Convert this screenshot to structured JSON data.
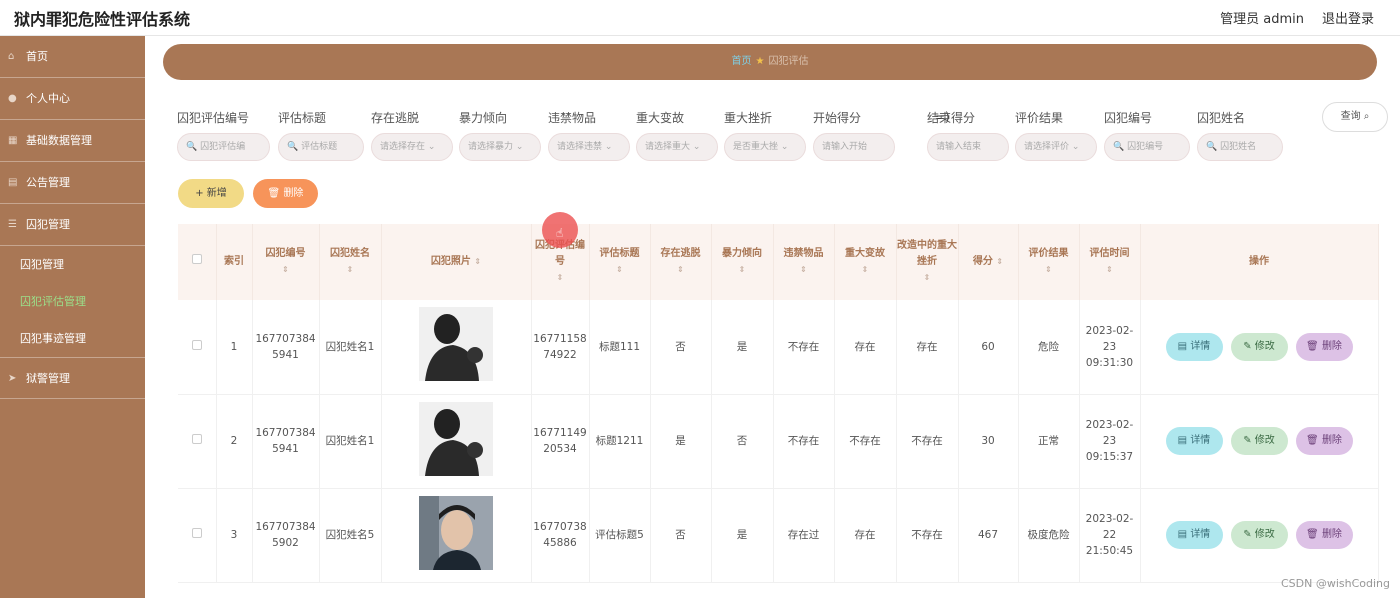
{
  "app": {
    "title": "狱内罪犯危险性评估系统",
    "user": "管理员 admin",
    "logout": "退出登录"
  },
  "sidebar": {
    "items": [
      {
        "label": "首页",
        "icon": "home-icon"
      },
      {
        "label": "个人中心",
        "icon": "user-icon"
      },
      {
        "label": "基础数据管理",
        "icon": "grid-icon"
      },
      {
        "label": "公告管理",
        "icon": "notice-icon"
      },
      {
        "label": "囚犯管理",
        "icon": "list-icon"
      }
    ],
    "subitems": [
      "囚犯管理",
      "囚犯评估管理",
      "囚犯事迹管理"
    ],
    "extra": {
      "label": "狱警管理",
      "icon": "send-icon"
    }
  },
  "breadcrumb": {
    "home": "首页",
    "current": "囚犯评估"
  },
  "filters": [
    {
      "label": "囚犯评估编号",
      "placeholder": "囚犯评估编"
    },
    {
      "label": "评估标题",
      "placeholder": "评估标题"
    },
    {
      "label": "存在逃脱",
      "placeholder": "请选择存在"
    },
    {
      "label": "暴力倾向",
      "placeholder": "请选择暴力"
    },
    {
      "label": "违禁物品",
      "placeholder": "请选择违禁"
    },
    {
      "label": "重大变故",
      "placeholder": "请选择重大"
    },
    {
      "label": "重大挫折",
      "placeholder": "是否重大挫"
    },
    {
      "label": "开始得分",
      "placeholder": "请输入开始"
    },
    {
      "label": "结束得分",
      "placeholder": "请输入结束"
    },
    {
      "label": "评价结果",
      "placeholder": "请选择评价"
    },
    {
      "label": "囚犯编号",
      "placeholder": "囚犯编号"
    },
    {
      "label": "囚犯姓名",
      "placeholder": "囚犯姓名"
    }
  ],
  "query_label": "查询",
  "buttons": {
    "add": "+ 新增",
    "delete": "删除"
  },
  "table": {
    "headers": [
      "索引",
      "囚犯编号",
      "囚犯姓名",
      "囚犯照片",
      "囚犯评估编号",
      "评估标题",
      "存在逃脱",
      "暴力倾向",
      "违禁物品",
      "重大变故",
      "改造中的重大挫折",
      "得分",
      "评价结果",
      "评估时间",
      "操作"
    ],
    "rows": [
      {
        "index": "1",
        "prisoner_no": "1677073845941",
        "name": "囚犯姓名1",
        "eval_no": "1677115874922",
        "title": "标题111",
        "escape": "否",
        "violence": "是",
        "contraband": "不存在",
        "change": "存在",
        "setback": "存在",
        "score": "60",
        "result": "危险",
        "time": "2023-02-23 09:31:30"
      },
      {
        "index": "2",
        "prisoner_no": "1677073845941",
        "name": "囚犯姓名1",
        "eval_no": "1677114920534",
        "title": "标题1211",
        "escape": "是",
        "violence": "否",
        "contraband": "不存在",
        "change": "不存在",
        "setback": "不存在",
        "score": "30",
        "result": "正常",
        "time": "2023-02-23 09:15:37"
      },
      {
        "index": "3",
        "prisoner_no": "1677073845902",
        "name": "囚犯姓名5",
        "eval_no": "1677073845886",
        "title": "评估标题5",
        "escape": "否",
        "violence": "是",
        "contraband": "存在过",
        "change": "存在",
        "setback": "不存在",
        "score": "467",
        "result": "极度危险",
        "time": "2023-02-22 21:50:45"
      }
    ],
    "actions": {
      "detail": "详情",
      "edit": "修改",
      "delete": "删除"
    }
  },
  "watermark": "CSDN @wishCoding"
}
